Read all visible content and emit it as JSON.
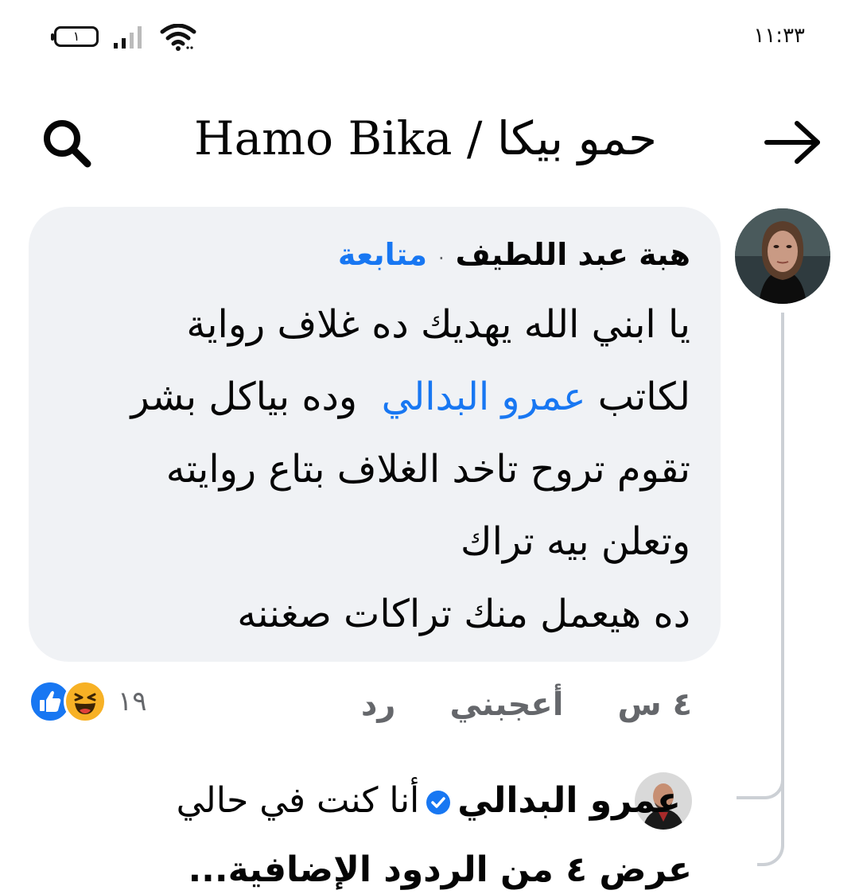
{
  "status_bar": {
    "battery_level": "١",
    "time": "١١:٣٣",
    "icons": [
      "battery-icon",
      "signal-icon",
      "wifi-icon"
    ]
  },
  "header": {
    "title": "Hamo Bika / حمو بيكا",
    "icons": [
      "search-icon",
      "arrow-right-icon"
    ]
  },
  "comment": {
    "author": "هبة عبد اللطيف",
    "separator": "·",
    "follow_label": "متابعة",
    "line1": "يا ابني الله يهديك ده غلاف رواية",
    "line2_prefix": "لكاتب ",
    "line2_mention": "عمرو البدالي",
    "line2_suffix": "  وده بياكل بشر",
    "line3": "تقوم تروح تاخد الغلاف بتاع روايته",
    "line4": "وتعلن بيه تراك",
    "line5": "ده هيعمل منك تراكات صغننه",
    "time": "٤ س",
    "like_label": "أعجبني",
    "reply_label": "رد",
    "reaction_count": "١٩",
    "reactions": [
      "like-icon",
      "haha-icon"
    ]
  },
  "reply": {
    "author": "عمرو البدالي",
    "text": "أنا كنت في حالي",
    "verified": true
  },
  "more_replies_label": "عرض ٤ من الردود الإضافية...",
  "colors": {
    "accent": "#1877f2",
    "bubble_bg": "#f0f2f5",
    "muted_text": "#65676b",
    "thread_line": "#ccd0d5",
    "haha": "#f7b125"
  }
}
